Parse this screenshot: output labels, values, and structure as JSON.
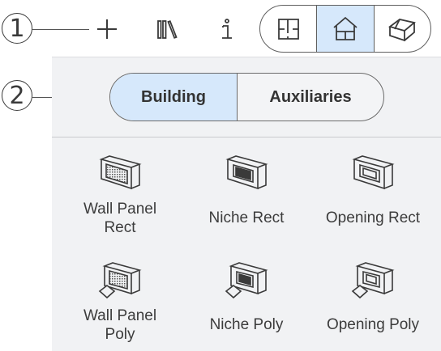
{
  "callouts": [
    "1",
    "2"
  ],
  "toolbar": {
    "icons": [
      "plus-icon",
      "library-icon",
      "info-icon"
    ],
    "view_modes": [
      "floor-plan-icon",
      "house-front-icon",
      "house-3d-icon"
    ],
    "active_view": "house-front-icon"
  },
  "segmented": {
    "options": [
      "Building",
      "Auxiliaries"
    ],
    "selected": "Building"
  },
  "tools": [
    {
      "label_lines": [
        "Wall Panel",
        "Rect"
      ],
      "icon": "wall-panel-rect-icon"
    },
    {
      "label_lines": [
        "Niche Rect"
      ],
      "icon": "niche-rect-icon"
    },
    {
      "label_lines": [
        "Opening Rect"
      ],
      "icon": "opening-rect-icon"
    },
    {
      "label_lines": [
        "Wall Panel",
        "Poly"
      ],
      "icon": "wall-panel-poly-icon"
    },
    {
      "label_lines": [
        "Niche Poly"
      ],
      "icon": "niche-poly-icon"
    },
    {
      "label_lines": [
        "Opening Poly"
      ],
      "icon": "opening-poly-icon"
    }
  ],
  "colors": {
    "active_bg": "#d6e8fb",
    "panel_bg": "#f1f2f4",
    "icon_stroke": "#3a3a3a"
  }
}
